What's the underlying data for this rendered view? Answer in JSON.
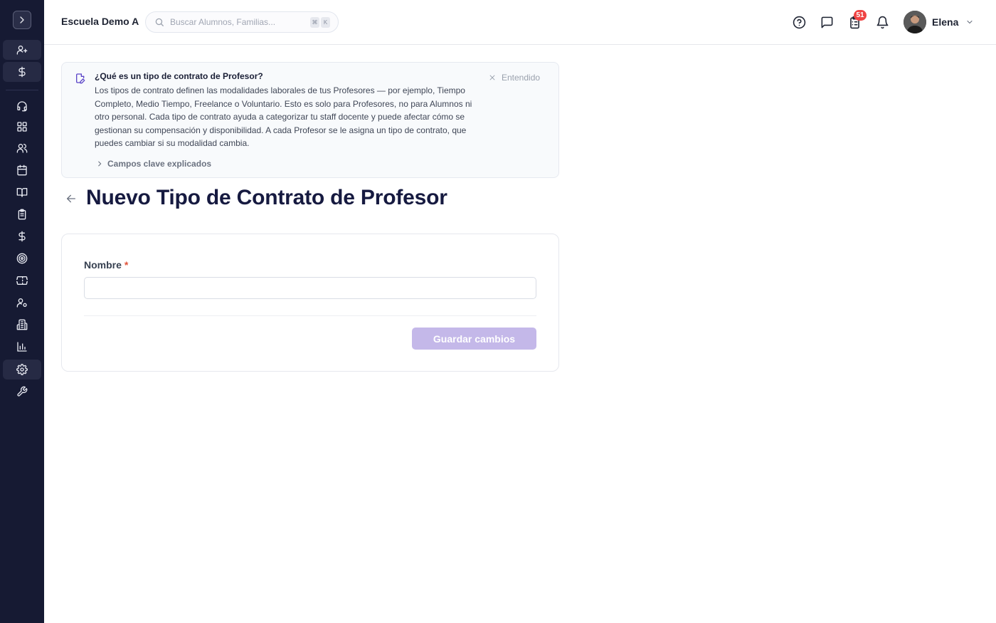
{
  "sidebar": {
    "toggle_icon": "chevron-right-icon",
    "items": [
      {
        "icon": "user-plus-icon",
        "active": true
      },
      {
        "icon": "dollar-icon",
        "active": true
      },
      {
        "icon": "headset-icon",
        "active": false
      },
      {
        "icon": "dashboard-icon",
        "active": false
      },
      {
        "icon": "users-icon",
        "active": false
      },
      {
        "icon": "calendar-icon",
        "active": false
      },
      {
        "icon": "book-open-icon",
        "active": false
      },
      {
        "icon": "clipboard-icon",
        "active": false
      },
      {
        "icon": "dollar-icon",
        "active": false
      },
      {
        "icon": "target-icon",
        "active": false
      },
      {
        "icon": "ticket-icon",
        "active": false
      },
      {
        "icon": "user-settings-icon",
        "active": false
      },
      {
        "icon": "building-icon",
        "active": false
      },
      {
        "icon": "bar-chart-icon",
        "active": false
      },
      {
        "icon": "gear-icon",
        "active": true
      },
      {
        "icon": "wrench-icon",
        "active": false
      }
    ]
  },
  "header": {
    "school_name": "Escuela Demo A",
    "search_placeholder": "Buscar Alumnos, Familias...",
    "shortcut_keys": [
      "⌘",
      "K"
    ],
    "notifications_badge": "51",
    "user_name": "Elena"
  },
  "info_card": {
    "title": "¿Qué es un tipo de contrato de Profesor?",
    "body": "Los tipos de contrato definen las modalidades laborales de tus Profesores — por ejemplo, Tiempo Completo, Medio Tiempo, Freelance o Voluntario. Esto es solo para Profesores, no para Alumnos ni otro personal. Cada tipo de contrato ayuda a categorizar tu staff docente y puede afectar cómo se gestionan su compensación y disponibilidad. A cada Profesor se le asigna un tipo de contrato, que puedes cambiar si su modalidad cambia.",
    "dismiss_label": "Entendido",
    "expander_label": "Campos clave explicados"
  },
  "page": {
    "title": "Nuevo Tipo de Contrato de Profesor"
  },
  "form": {
    "name_label": "Nombre",
    "required_mark": "*",
    "name_value": "",
    "save_label": "Guardar cambios",
    "save_enabled": false,
    "save_color": "#c4b8e9"
  },
  "colors": {
    "sidebar_bg": "#161a33",
    "title_color": "#161a40",
    "badge": "#ef4444"
  }
}
